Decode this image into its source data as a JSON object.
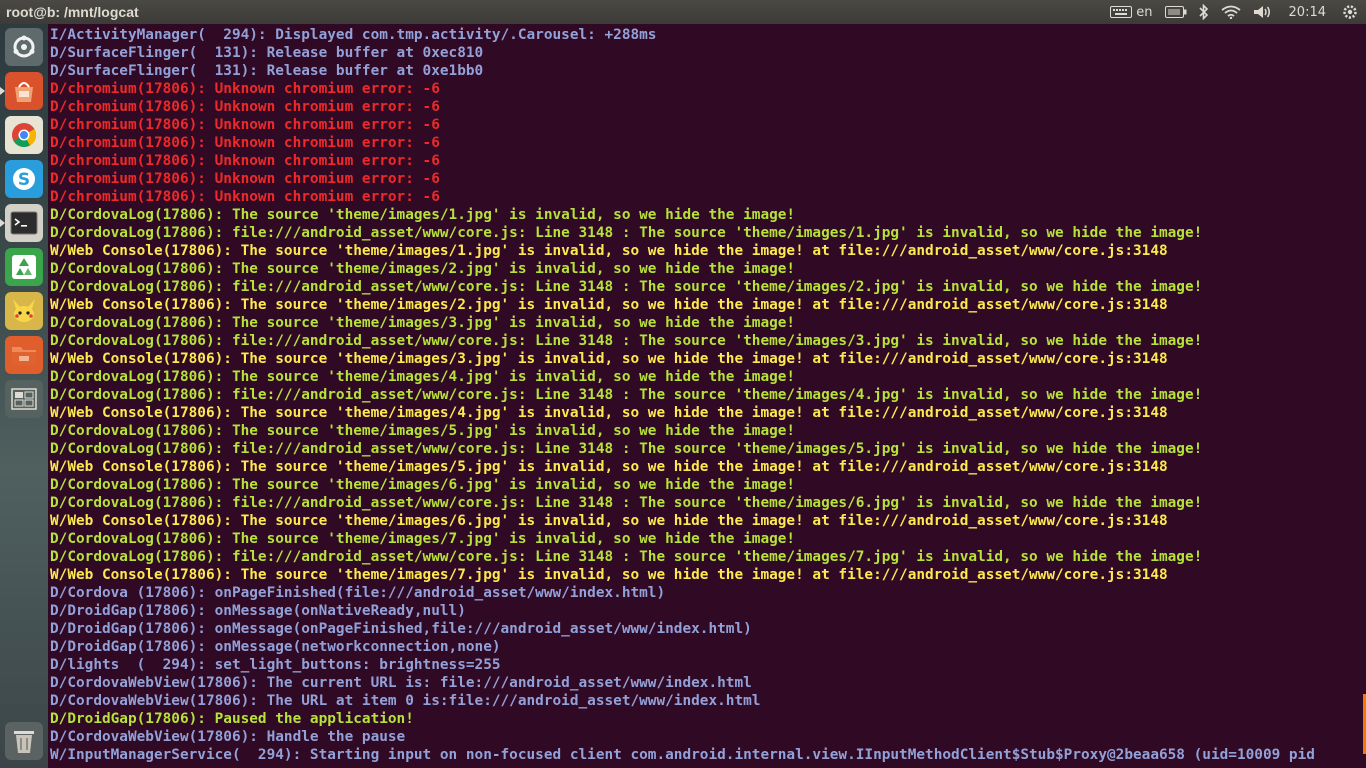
{
  "window": {
    "title": "root@b: /mnt/logcat"
  },
  "indicators": {
    "keyboard_layout": "en",
    "clock": "20:14"
  },
  "launcher": {
    "items": [
      {
        "name": "dash-home-icon"
      },
      {
        "name": "software-center-icon"
      },
      {
        "name": "chrome-icon"
      },
      {
        "name": "skype-icon"
      },
      {
        "name": "terminal-icon"
      },
      {
        "name": "recycle-app-icon"
      },
      {
        "name": "pikachu-app-icon"
      },
      {
        "name": "files-folder-icon"
      },
      {
        "name": "workspace-switcher-icon"
      },
      {
        "name": "trash-icon"
      }
    ]
  },
  "colors": {
    "info": "#93a1d9",
    "error": "#ef2929",
    "debug": "#b7e23b",
    "warn": "#fce94f",
    "background": "#300a24"
  },
  "log": [
    {
      "level": "info",
      "text": "I/ActivityManager(  294): Displayed com.tmp.activity/.Carousel: +288ms"
    },
    {
      "level": "info",
      "text": "D/SurfaceFlinger(  131): Release buffer at 0xec810"
    },
    {
      "level": "info",
      "text": "D/SurfaceFlinger(  131): Release buffer at 0xe1bb0"
    },
    {
      "level": "error",
      "text": "D/chromium(17806): Unknown chromium error: -6"
    },
    {
      "level": "error",
      "text": "D/chromium(17806): Unknown chromium error: -6"
    },
    {
      "level": "error",
      "text": "D/chromium(17806): Unknown chromium error: -6"
    },
    {
      "level": "error",
      "text": "D/chromium(17806): Unknown chromium error: -6"
    },
    {
      "level": "error",
      "text": "D/chromium(17806): Unknown chromium error: -6"
    },
    {
      "level": "error",
      "text": "D/chromium(17806): Unknown chromium error: -6"
    },
    {
      "level": "error",
      "text": "D/chromium(17806): Unknown chromium error: -6"
    },
    {
      "level": "debug",
      "text": "D/CordovaLog(17806): The source 'theme/images/1.jpg' is invalid, so we hide the image!"
    },
    {
      "level": "debug",
      "text": "D/CordovaLog(17806): file:///android_asset/www/core.js: Line 3148 : The source 'theme/images/1.jpg' is invalid, so we hide the image!"
    },
    {
      "level": "warn",
      "text": "W/Web Console(17806): The source 'theme/images/1.jpg' is invalid, so we hide the image! at file:///android_asset/www/core.js:3148"
    },
    {
      "level": "debug",
      "text": "D/CordovaLog(17806): The source 'theme/images/2.jpg' is invalid, so we hide the image!"
    },
    {
      "level": "debug",
      "text": "D/CordovaLog(17806): file:///android_asset/www/core.js: Line 3148 : The source 'theme/images/2.jpg' is invalid, so we hide the image!"
    },
    {
      "level": "warn",
      "text": "W/Web Console(17806): The source 'theme/images/2.jpg' is invalid, so we hide the image! at file:///android_asset/www/core.js:3148"
    },
    {
      "level": "debug",
      "text": "D/CordovaLog(17806): The source 'theme/images/3.jpg' is invalid, so we hide the image!"
    },
    {
      "level": "debug",
      "text": "D/CordovaLog(17806): file:///android_asset/www/core.js: Line 3148 : The source 'theme/images/3.jpg' is invalid, so we hide the image!"
    },
    {
      "level": "warn",
      "text": "W/Web Console(17806): The source 'theme/images/3.jpg' is invalid, so we hide the image! at file:///android_asset/www/core.js:3148"
    },
    {
      "level": "debug",
      "text": "D/CordovaLog(17806): The source 'theme/images/4.jpg' is invalid, so we hide the image!"
    },
    {
      "level": "debug",
      "text": "D/CordovaLog(17806): file:///android_asset/www/core.js: Line 3148 : The source 'theme/images/4.jpg' is invalid, so we hide the image!"
    },
    {
      "level": "warn",
      "text": "W/Web Console(17806): The source 'theme/images/4.jpg' is invalid, so we hide the image! at file:///android_asset/www/core.js:3148"
    },
    {
      "level": "debug",
      "text": "D/CordovaLog(17806): The source 'theme/images/5.jpg' is invalid, so we hide the image!"
    },
    {
      "level": "debug",
      "text": "D/CordovaLog(17806): file:///android_asset/www/core.js: Line 3148 : The source 'theme/images/5.jpg' is invalid, so we hide the image!"
    },
    {
      "level": "warn",
      "text": "W/Web Console(17806): The source 'theme/images/5.jpg' is invalid, so we hide the image! at file:///android_asset/www/core.js:3148"
    },
    {
      "level": "debug",
      "text": "D/CordovaLog(17806): The source 'theme/images/6.jpg' is invalid, so we hide the image!"
    },
    {
      "level": "debug",
      "text": "D/CordovaLog(17806): file:///android_asset/www/core.js: Line 3148 : The source 'theme/images/6.jpg' is invalid, so we hide the image!"
    },
    {
      "level": "warn",
      "text": "W/Web Console(17806): The source 'theme/images/6.jpg' is invalid, so we hide the image! at file:///android_asset/www/core.js:3148"
    },
    {
      "level": "debug",
      "text": "D/CordovaLog(17806): The source 'theme/images/7.jpg' is invalid, so we hide the image!"
    },
    {
      "level": "debug",
      "text": "D/CordovaLog(17806): file:///android_asset/www/core.js: Line 3148 : The source 'theme/images/7.jpg' is invalid, so we hide the image!"
    },
    {
      "level": "warn",
      "text": "W/Web Console(17806): The source 'theme/images/7.jpg' is invalid, so we hide the image! at file:///android_asset/www/core.js:3148"
    },
    {
      "level": "info",
      "text": "D/Cordova (17806): onPageFinished(file:///android_asset/www/index.html)"
    },
    {
      "level": "info",
      "text": "D/DroidGap(17806): onMessage(onNativeReady,null)"
    },
    {
      "level": "info",
      "text": "D/DroidGap(17806): onMessage(onPageFinished,file:///android_asset/www/index.html)"
    },
    {
      "level": "info",
      "text": "D/DroidGap(17806): onMessage(networkconnection,none)"
    },
    {
      "level": "info",
      "text": "D/lights  (  294): set_light_buttons: brightness=255"
    },
    {
      "level": "info",
      "text": "D/CordovaWebView(17806): The current URL is: file:///android_asset/www/index.html"
    },
    {
      "level": "info",
      "text": "D/CordovaWebView(17806): The URL at item 0 is:file:///android_asset/www/index.html"
    },
    {
      "level": "debug",
      "text": "D/DroidGap(17806): Paused the application!"
    },
    {
      "level": "info",
      "text": "D/CordovaWebView(17806): Handle the pause"
    },
    {
      "level": "info",
      "text": "W/InputManagerService(  294): Starting input on non-focused client com.android.internal.view.IInputMethodClient$Stub$Proxy@2beaa658 (uid=10009 pid"
    }
  ]
}
